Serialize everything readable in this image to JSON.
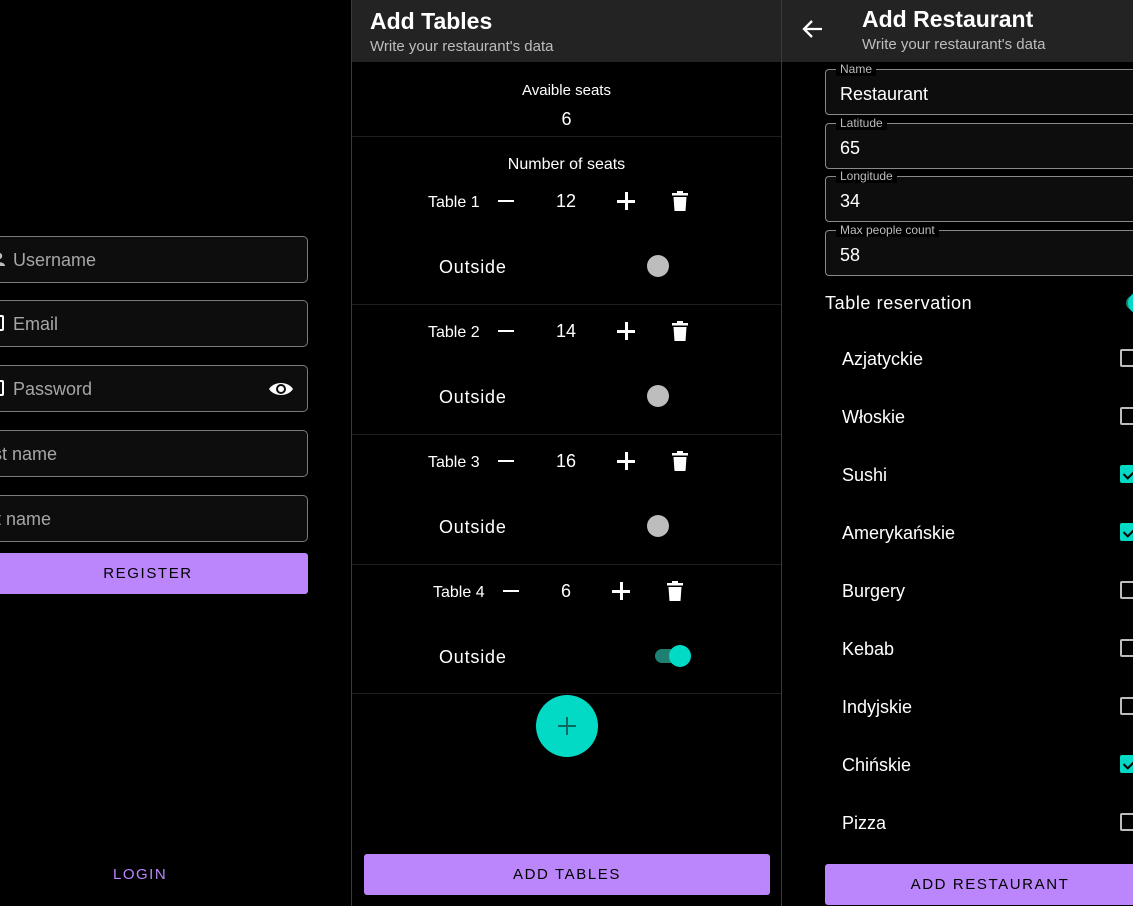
{
  "register": {
    "username_placeholder": "Username",
    "email_placeholder": "Email",
    "password_placeholder": "Password",
    "first_name_placeholder": "rst name",
    "last_name_placeholder": "st name",
    "register_label": "REGISTER",
    "login_label": "LOGIN"
  },
  "tables": {
    "title": "Add Tables",
    "subtitle": "Write your restaurant's data",
    "available_label": "Avaible seats",
    "available_value": "6",
    "number_of_seats_label": "Number of seats",
    "outside_label": "Outside",
    "rows": [
      {
        "label": "Table 1",
        "seats": "12",
        "outside": false
      },
      {
        "label": "Table 2",
        "seats": "14",
        "outside": false
      },
      {
        "label": "Table 3",
        "seats": "16",
        "outside": false
      },
      {
        "label": "Table 4",
        "seats": "6",
        "outside": true
      }
    ],
    "add_tables_label": "ADD TABLES"
  },
  "restaurant": {
    "title": "Add Restaurant",
    "subtitle": "Write your restaurant's data",
    "fields": [
      {
        "label": "Name",
        "value": "Restaurant"
      },
      {
        "label": "Latitude",
        "value": "65"
      },
      {
        "label": "Longitude",
        "value": "34"
      },
      {
        "label": "Max people count",
        "value": "58"
      }
    ],
    "table_reservation_label": "Table reservation",
    "table_reservation_on": true,
    "categories": [
      {
        "label": "Azjatyckie",
        "checked": false
      },
      {
        "label": "Włoskie",
        "checked": false
      },
      {
        "label": "Sushi",
        "checked": true
      },
      {
        "label": "Amerykańskie",
        "checked": true
      },
      {
        "label": "Burgery",
        "checked": false
      },
      {
        "label": "Kebab",
        "checked": false
      },
      {
        "label": "Indyjskie",
        "checked": false
      },
      {
        "label": "Chińskie",
        "checked": true
      },
      {
        "label": "Pizza",
        "checked": false
      }
    ],
    "add_restaurant_label": "ADD RESTAURANT"
  },
  "colors": {
    "accent_purple": "#bb86fc",
    "accent_teal": "#03dac5",
    "appbar": "#232323",
    "background": "#000000"
  }
}
